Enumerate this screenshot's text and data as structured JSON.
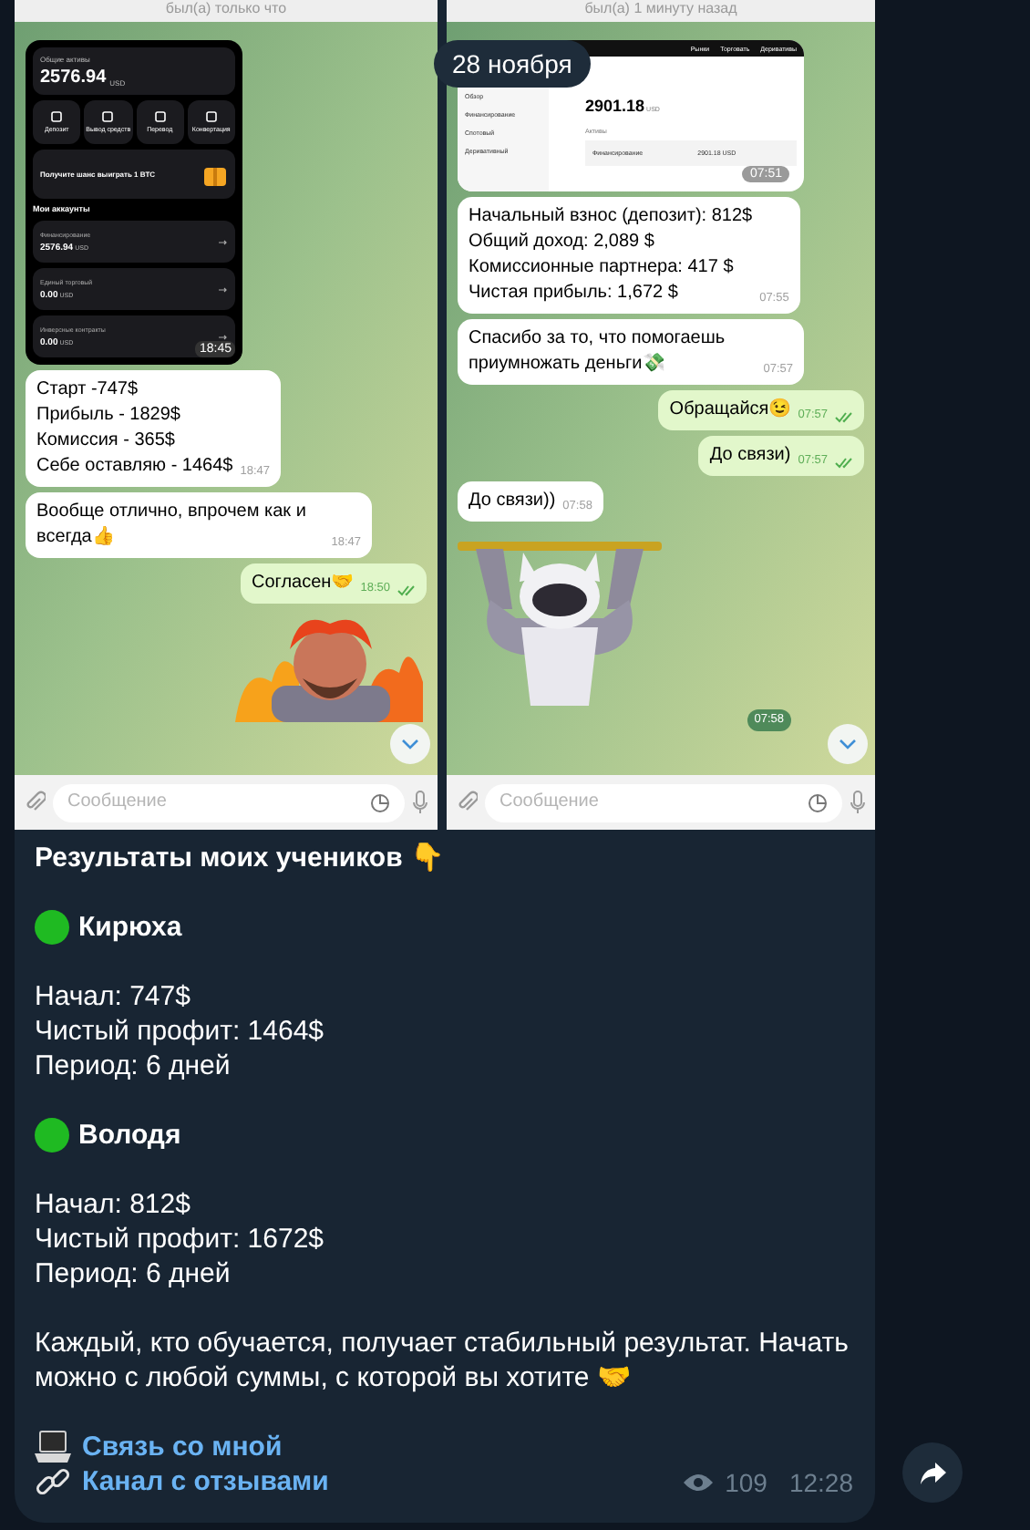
{
  "date_badge": "28 ноября",
  "screenshots": [
    {
      "status": "был(а) только что",
      "app": {
        "kind": "mobile",
        "total_label": "Общие активы",
        "total": "2576.94",
        "currency": "USD",
        "actions": [
          "Депозит",
          "Вывод средств",
          "Перевод",
          "Конвертация"
        ],
        "promo_title": "Получите шанс выиграть 1 BTC",
        "accounts_title": "Мои аккаунты",
        "accounts": [
          {
            "name": "Финансирование",
            "amount": "2576.94",
            "currency": "USD"
          },
          {
            "name": "Единый торговый",
            "amount": "0.00",
            "currency": "USD"
          },
          {
            "name": "Инверсные контракты",
            "amount": "0.00",
            "currency": "USD"
          }
        ],
        "time": "18:45"
      },
      "messages": [
        {
          "kind": "incoming",
          "text": "Старт -747$\nПрибыль - 1829$\nКомиссия - 365$\nСебе оставляю - 1464$",
          "time": "18:47"
        },
        {
          "kind": "incoming",
          "text": "Вообще отлично, впрочем как и всегда👍",
          "time": "18:47"
        },
        {
          "kind": "outgoing",
          "text": "Согласен🤝",
          "time": "18:50"
        },
        {
          "kind": "sticker"
        }
      ],
      "placeholder": "Сообщение"
    },
    {
      "status": "был(а) 1 минуту назад",
      "app": {
        "kind": "web",
        "nav": [
          "Рынки",
          "Торговать",
          "Деривативы"
        ],
        "sidebar": [
          "Обзор",
          "Финансирование",
          "Спотовый",
          "Деривативный"
        ],
        "total": "2901.18",
        "currency": "USD",
        "section": "Активы",
        "row_name": "Финансирование",
        "row_amount": "2901.18 USD",
        "time": "07:51"
      },
      "messages": [
        {
          "kind": "incoming",
          "text": "Начальный взнос (депозит): 812$\nОбщий доход: 2,089 $\nКомиссионные партнера: 417 $\nЧистая прибыль: 1,672 $",
          "time": "07:55"
        },
        {
          "kind": "incoming",
          "text": "Спасибо за то, что помогаешь приумножать деньги💸",
          "time": "07:57"
        },
        {
          "kind": "outgoing",
          "text": "Обращайся😉",
          "time": "07:57"
        },
        {
          "kind": "outgoing",
          "text": "До связи)",
          "time": "07:57"
        },
        {
          "kind": "incoming",
          "text": "До связи))",
          "time": "07:58"
        },
        {
          "kind": "sticker",
          "time": "07:58"
        }
      ],
      "placeholder": "Сообщение"
    }
  ],
  "post": {
    "title": "Результаты моих учеников 👇",
    "students": [
      {
        "name": "Кирюха",
        "color": "#1fba22",
        "lines": [
          "Начал: 747$",
          "Чистый профит: 1464$",
          "Период: 6 дней"
        ]
      },
      {
        "name": "Володя",
        "color": "#1fba22",
        "lines": [
          "Начал: 812$",
          "Чистый профит: 1672$",
          "Период: 6 дней"
        ]
      }
    ],
    "closing": "Каждый, кто обучается, получает стабильный результат. Начать можно с любой суммы, с которой вы хотите 🤝",
    "links": [
      {
        "kind": "contact",
        "text": "Связь со мной"
      },
      {
        "kind": "reviews",
        "text": "Канал с отзывами"
      }
    ],
    "views": "109",
    "time": "12:28"
  }
}
